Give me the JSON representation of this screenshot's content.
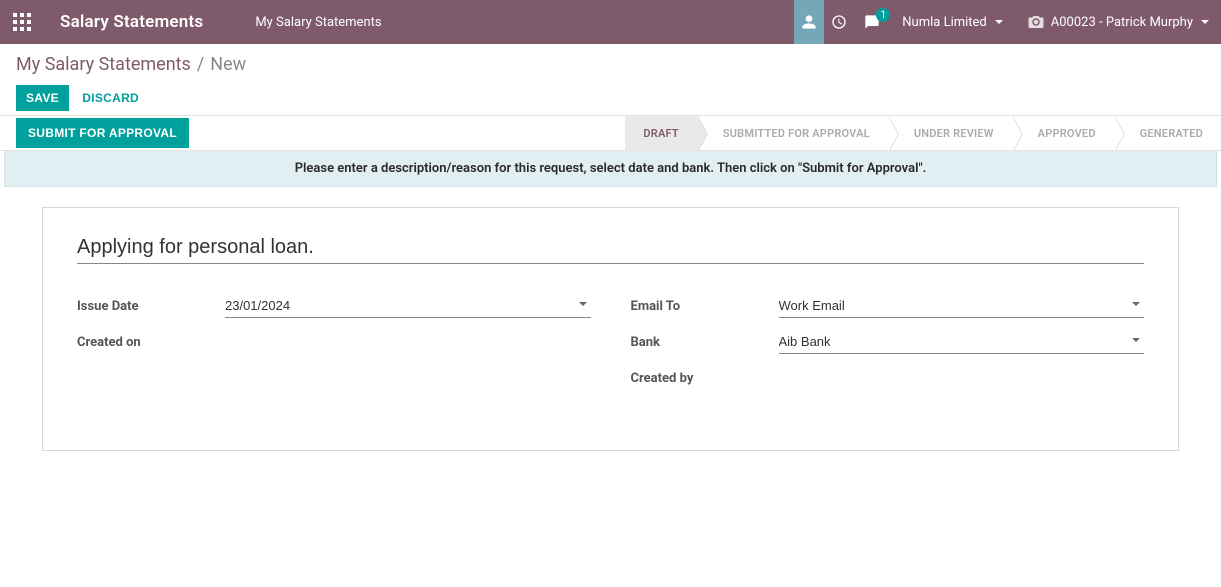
{
  "topbar": {
    "brand": "Salary Statements",
    "menu_item": "My Salary Statements",
    "company": "Numla Limited",
    "user": "A00023 - Patrick Murphy",
    "chat_count": "1"
  },
  "breadcrumb": {
    "root": "My Salary Statements",
    "current": "New"
  },
  "buttons": {
    "save": "SAVE",
    "discard": "DISCARD",
    "submit": "SUBMIT FOR APPROVAL"
  },
  "status": {
    "draft": "DRAFT",
    "submitted": "SUBMITTED FOR APPROVAL",
    "review": "UNDER REVIEW",
    "approved": "APPROVED",
    "generated": "GENERATED"
  },
  "banner": "Please enter a description/reason for this request, select date and bank. Then click on \"Submit for Approval\".",
  "form": {
    "title": "Applying for personal loan.",
    "labels": {
      "issue_date": "Issue Date",
      "created_on": "Created on",
      "email_to": "Email To",
      "bank": "Bank",
      "created_by": "Created by"
    },
    "values": {
      "issue_date": "23/01/2024",
      "email_to": "Work Email",
      "bank": "Aib Bank"
    }
  }
}
